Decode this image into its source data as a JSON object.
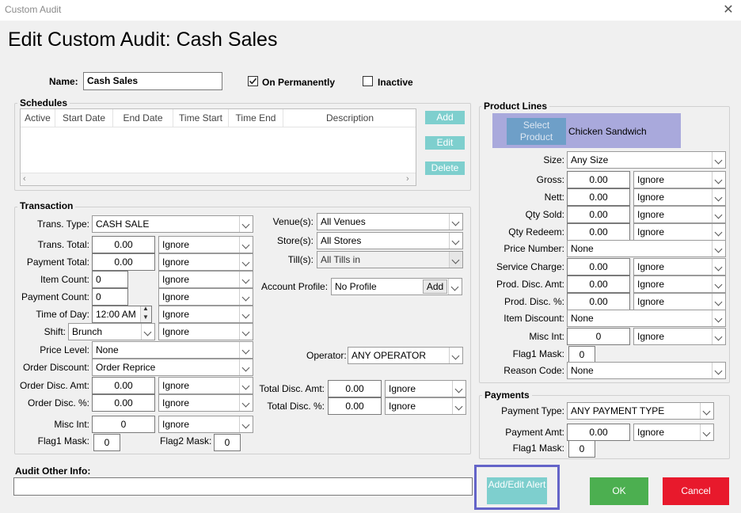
{
  "window": {
    "title": "Custom Audit",
    "close_glyph": "✕"
  },
  "heading": "Edit Custom Audit: Cash Sales",
  "name_label": "Name:",
  "name_value": "Cash Sales",
  "on_permanently": {
    "label": "On Permanently",
    "checked": true
  },
  "inactive": {
    "label": "Inactive",
    "checked": false
  },
  "schedules": {
    "title": "Schedules",
    "columns": [
      "Active",
      "Start Date",
      "End Date",
      "Time Start",
      "Time End",
      "Description"
    ],
    "add": "Add",
    "edit": "Edit",
    "delete": "Delete"
  },
  "transaction": {
    "title": "Transaction",
    "trans_type": {
      "label": "Trans. Type:",
      "value": "CASH SALE"
    },
    "trans_total": {
      "label": "Trans. Total:",
      "value": "0.00",
      "op": "Ignore"
    },
    "payment_total": {
      "label": "Payment Total:",
      "value": "0.00",
      "op": "Ignore"
    },
    "item_count": {
      "label": "Item Count:",
      "value": "0",
      "op": "Ignore"
    },
    "payment_count": {
      "label": "Payment Count:",
      "value": "0",
      "op": "Ignore"
    },
    "time_of_day": {
      "label": "Time of Day:",
      "value": "12:00 AM",
      "op": "Ignore"
    },
    "shift": {
      "label": "Shift:",
      "value": "Brunch",
      "op": "Ignore"
    },
    "price_level": {
      "label": "Price Level:",
      "value": "None"
    },
    "order_discount": {
      "label": "Order Discount:",
      "value": "Order Reprice"
    },
    "order_disc_amt": {
      "label": "Order Disc. Amt:",
      "value": "0.00",
      "op": "Ignore"
    },
    "order_disc_pct": {
      "label": "Order Disc. %:",
      "value": "0.00",
      "op": "Ignore"
    },
    "misc_int": {
      "label": "Misc Int:",
      "value": "0",
      "op": "Ignore"
    },
    "flag1": {
      "label": "Flag1 Mask:",
      "value": "0"
    },
    "flag2": {
      "label": "Flag2 Mask:",
      "value": "0"
    },
    "venues": {
      "label": "Venue(s):",
      "value": "All Venues"
    },
    "stores": {
      "label": "Store(s):",
      "value": "All Stores"
    },
    "tills": {
      "label": "Till(s):",
      "value": "All Tills in"
    },
    "account_profile": {
      "label": "Account Profile:",
      "value": "No Profile",
      "add": "Add"
    },
    "operator": {
      "label": "Operator:",
      "value": "ANY OPERATOR"
    },
    "total_disc_amt": {
      "label": "Total Disc. Amt:",
      "value": "0.00",
      "op": "Ignore"
    },
    "total_disc_pct": {
      "label": "Total Disc. %:",
      "value": "0.00",
      "op": "Ignore"
    }
  },
  "product_lines": {
    "title": "Product Lines",
    "select_product": "Select Product",
    "product_name": "Chicken Sandwich",
    "size": {
      "label": "Size:",
      "value": "Any Size"
    },
    "gross": {
      "label": "Gross:",
      "value": "0.00",
      "op": "Ignore"
    },
    "nett": {
      "label": "Nett:",
      "value": "0.00",
      "op": "Ignore"
    },
    "qty_sold": {
      "label": "Qty Sold:",
      "value": "0.00",
      "op": "Ignore"
    },
    "qty_redeem": {
      "label": "Qty Redeem:",
      "value": "0.00",
      "op": "Ignore"
    },
    "price_number": {
      "label": "Price Number:",
      "value": "None"
    },
    "service_charge": {
      "label": "Service Charge:",
      "value": "0.00",
      "op": "Ignore"
    },
    "prod_disc_amt": {
      "label": "Prod. Disc. Amt:",
      "value": "0.00",
      "op": "Ignore"
    },
    "prod_disc_pct": {
      "label": "Prod. Disc. %:",
      "value": "0.00",
      "op": "Ignore"
    },
    "item_discount": {
      "label": "Item Discount:",
      "value": "None"
    },
    "misc_int": {
      "label": "Misc Int:",
      "value": "0",
      "op": "Ignore"
    },
    "flag1": {
      "label": "Flag1 Mask:",
      "value": "0"
    },
    "reason_code": {
      "label": "Reason Code:",
      "value": "None"
    }
  },
  "payments": {
    "title": "Payments",
    "payment_type": {
      "label": "Payment Type:",
      "value": "ANY PAYMENT TYPE"
    },
    "payment_amt": {
      "label": "Payment Amt:",
      "value": "0.00",
      "op": "Ignore"
    },
    "flag1": {
      "label": "Flag1 Mask:",
      "value": "0"
    }
  },
  "audit_other_info": {
    "label": "Audit Other Info:",
    "value": ""
  },
  "buttons": {
    "add_edit_alert": "Add/Edit Alert",
    "ok": "OK",
    "cancel": "Cancel"
  },
  "colors": {
    "ok": "#4caf50",
    "cancel": "#e8192c",
    "teal": "#7ecfce",
    "product_panel": "#a9a9dc",
    "highlight": "#6464c8"
  }
}
